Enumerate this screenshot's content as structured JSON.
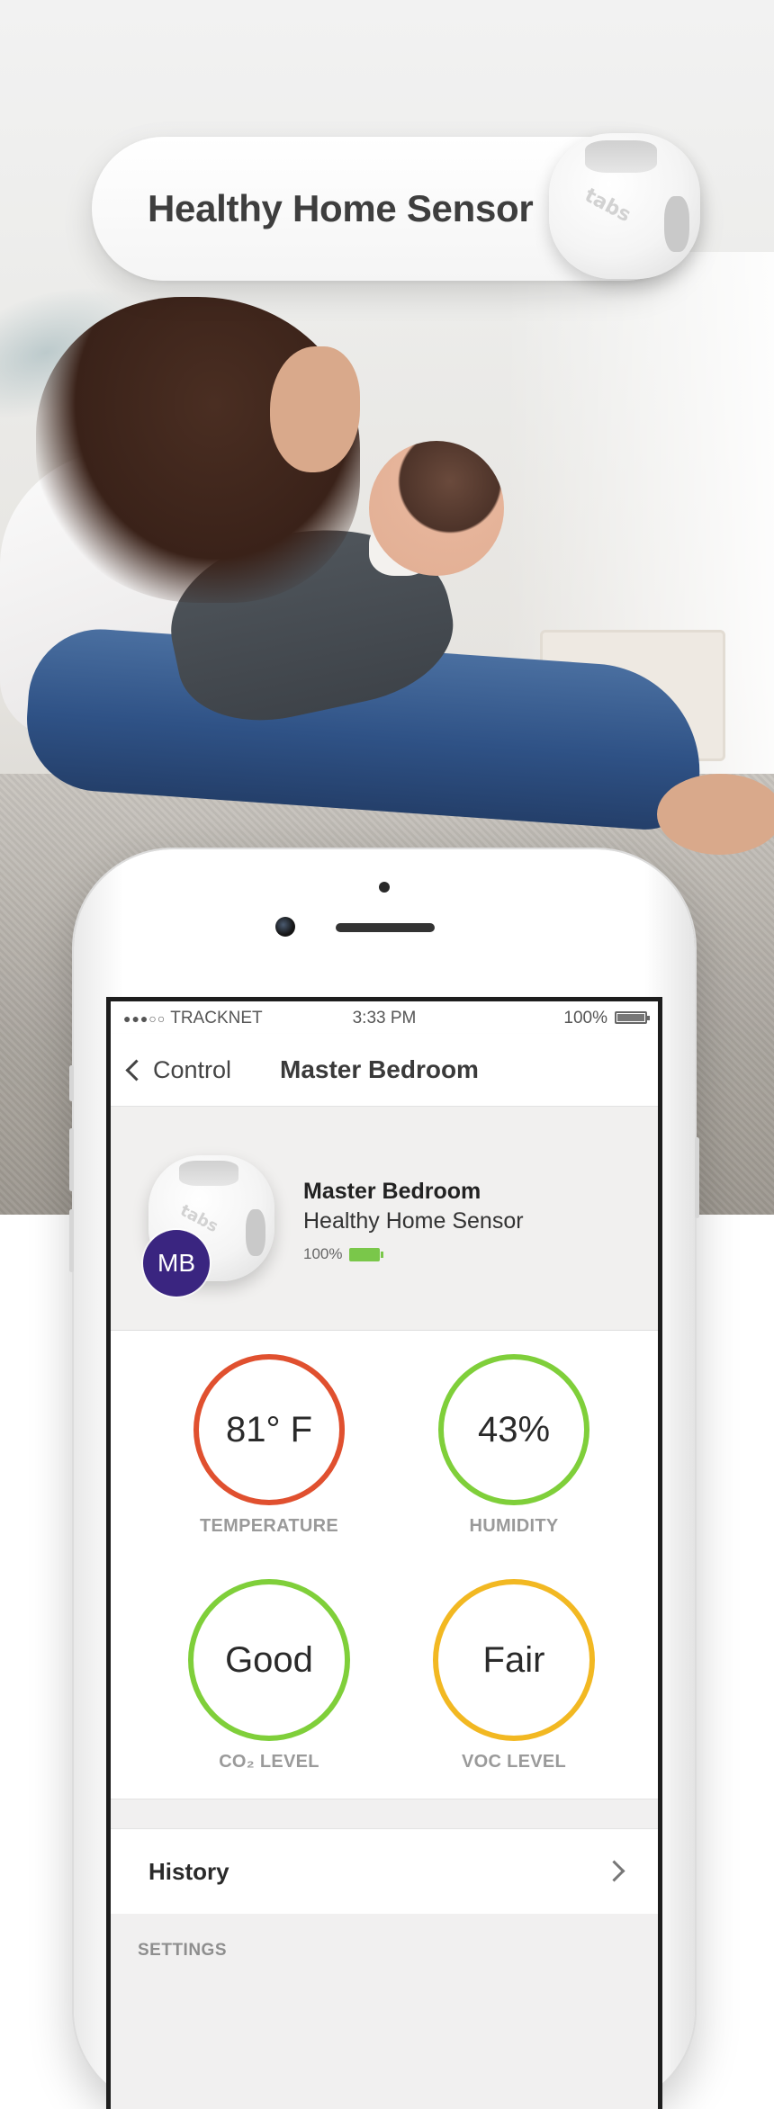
{
  "promo": {
    "title": "Healthy Home Sensor",
    "sensor_brand": "tabs"
  },
  "status_bar": {
    "signal_dots": "●●●○○",
    "carrier": "TRACKNET",
    "time": "3:33 PM",
    "battery": "100%"
  },
  "nav": {
    "back_label": "Control",
    "title": "Master Bedroom"
  },
  "device": {
    "avatar_initials": "MB",
    "name": "Master Bedroom",
    "model": "Healthy Home Sensor",
    "battery": "100%",
    "brand": "tabs"
  },
  "gauges": [
    {
      "value": "81° F",
      "label": "TEMPERATURE",
      "color": "#e0502f"
    },
    {
      "value": "43%",
      "label": "HUMIDITY",
      "color": "#7fcf3a"
    },
    {
      "value": "Good",
      "label": "CO₂ LEVEL",
      "color": "#7fcf3a"
    },
    {
      "value": "Fair",
      "label": "VOC LEVEL",
      "color": "#f2b822"
    }
  ],
  "history": {
    "label": "History"
  },
  "settings": {
    "header": "SETTINGS"
  },
  "colors": {
    "avatar": "#3a2580",
    "battery_green": "#7ac74a"
  }
}
